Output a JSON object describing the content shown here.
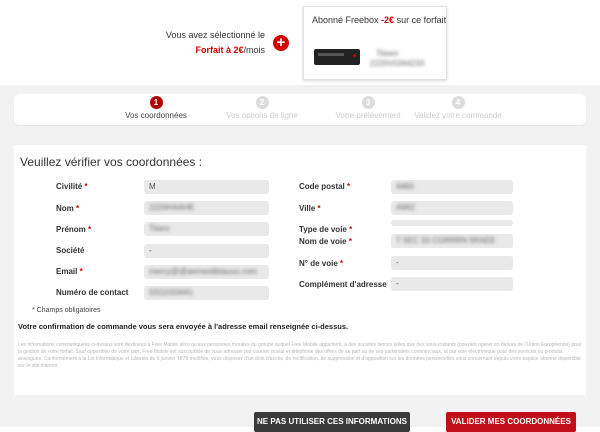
{
  "header": {
    "offer_line1": "Vous avez sélectionné le",
    "offer_name": "Forfait à 2€",
    "offer_suffix": "/mois",
    "plus_icon": "plus-circle-icon",
    "card": {
      "title_prefix": "Abonné Freebox ",
      "title_discount": "-2€",
      "title_suffix": " sur ce forfait",
      "blur_line1": "Titeerr",
      "blur_line2": "2220V0344233"
    }
  },
  "stepper": {
    "steps": [
      {
        "number": "1",
        "label": "Vos coordonnées",
        "active": true
      },
      {
        "number": "2",
        "label": "Vos options de ligne",
        "active": false
      },
      {
        "number": "3",
        "label": "Votre prélèvement",
        "active": false
      },
      {
        "number": "4",
        "label": "Validez votre commande",
        "active": false
      }
    ]
  },
  "form": {
    "title": "Veuillez vérifier vos coordonnées :",
    "left_fields": [
      {
        "label": "Civilité",
        "required": true,
        "value": "M"
      },
      {
        "label": "Nom",
        "required": true,
        "value": "2220HAAHE"
      },
      {
        "label": "Prénom",
        "required": true,
        "value": "Tiiwrs"
      },
      {
        "label": "Société",
        "required": false,
        "value": "-"
      },
      {
        "label": "Email",
        "required": true,
        "value": "mercy@@aemestibtauuu.com"
      },
      {
        "label": "Numéro de contact",
        "required": false,
        "value": "0311033441"
      }
    ],
    "right_fields": [
      {
        "label": "Code postal",
        "required": true,
        "value": "4460"
      },
      {
        "label": "Ville",
        "required": true,
        "value": "AMIZ"
      },
      {
        "label": "Type de voie",
        "required": true,
        "value": ""
      },
      {
        "label": "Nom de voie",
        "required": true,
        "value": "T 5EC 33 CGRRRN 5RAEE"
      },
      {
        "label": "N° de voie",
        "required": true,
        "value": "-"
      },
      {
        "label": "Complément d'adresse",
        "required": false,
        "value": "-"
      }
    ],
    "required_note": "* Champs obligatoires",
    "confirmation": "Votre confirmation de commande vous sera envoyée à l'adresse email renseignée ci-dessus.",
    "legal": "Les informations communiquées ci-dessus sont destinées à Free Mobile ainsi qu'aux personnes morales du groupe auquel Free Mobile appartient, à des sociétés tierces telles que des sous-traitants (pouvant opérer en dehors de l'Union Européenne) pour la gestion de votre forfait. Sauf opposition de votre part, Free Mobile est susceptible de vous adresser par courrier postal et téléphone des offres de sa part ou de ses partenaires commerciaux, et par voie électronique pour des services ou produits analogues. Conformément à la Loi Informatique et Libertés du 6 janvier 1978 modifiée, vous disposez d'un droit d'accès, de rectification, de suppression et d'opposition sur les données personnelles vous concernant depuis votre espace abonné disponible sur le site internet."
  },
  "actions": {
    "decline_label": "NE PAS UTILISER CES INFORMATIONS",
    "validate_label": "VALIDER MES COORDONNÉES"
  }
}
